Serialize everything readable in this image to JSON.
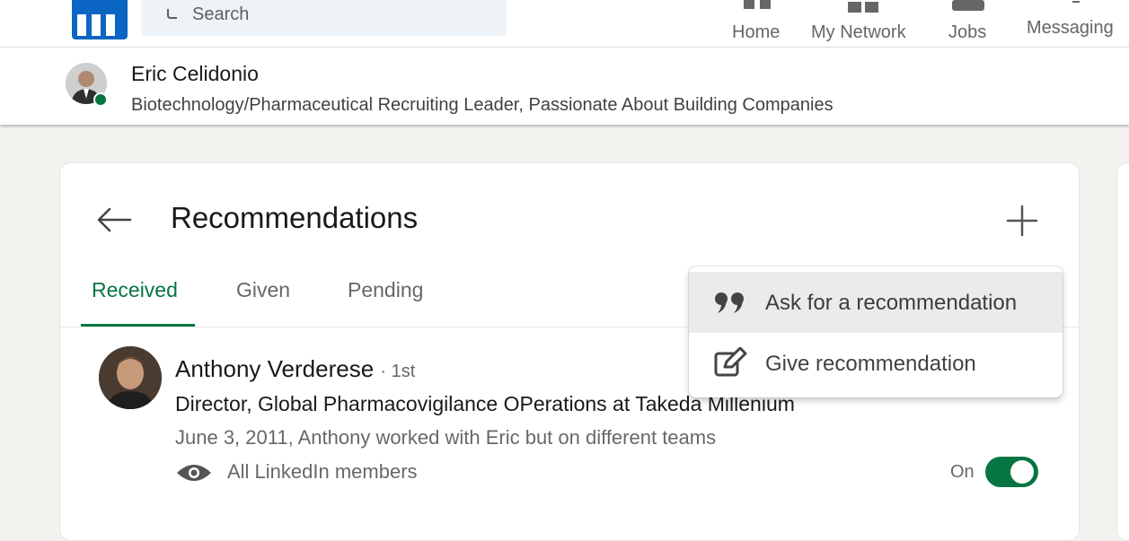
{
  "header": {
    "search": {
      "placeholder": "Search"
    },
    "nav": [
      {
        "label": "Home",
        "icon": "home-icon"
      },
      {
        "label": "My Network",
        "icon": "network-icon"
      },
      {
        "label": "Jobs",
        "icon": "jobs-icon"
      },
      {
        "label": "Messaging",
        "icon": "messaging-icon"
      }
    ]
  },
  "profile": {
    "name": "Eric Celidonio",
    "headline": "Biotechnology/Pharmaceutical Recruiting Leader, Passionate About Building Companies",
    "online": true
  },
  "recommendations": {
    "title": "Recommendations",
    "tabs": [
      {
        "label": "Received",
        "active": true
      },
      {
        "label": "Given",
        "active": false
      },
      {
        "label": "Pending",
        "active": false
      }
    ],
    "items": [
      {
        "name": "Anthony Verderese",
        "degree": "· 1st",
        "title": "Director, Global Pharmacovigilance OPerations at Takeda Millenium",
        "date_relation": "June 3, 2011, Anthony worked with Eric but on different teams",
        "visibility": "All LinkedIn members",
        "toggle_label": "On",
        "toggle_on": true
      }
    ]
  },
  "menu": {
    "items": [
      {
        "label": "Ask for a recommendation",
        "icon": "quote-icon",
        "hovered": true
      },
      {
        "label": "Give recommendation",
        "icon": "edit-icon",
        "hovered": false
      }
    ]
  },
  "colors": {
    "brand": "#0a66c2",
    "accent_green": "#057642",
    "page_bg": "#f3f2ef"
  }
}
